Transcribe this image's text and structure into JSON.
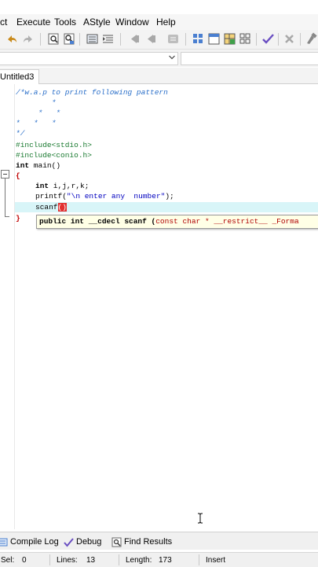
{
  "menubar": {
    "items": [
      "ct",
      "Execute",
      "Tools",
      "AStyle",
      "Window",
      "Help"
    ]
  },
  "toolbar": {
    "icons": [
      "undo-icon",
      "redo-icon",
      "find-icon",
      "replace-icon",
      "indent-icon",
      "unindent-icon",
      "bookmark-prev-icon",
      "bookmark-next-icon",
      "bookmark-toggle-icon",
      "grid-icon",
      "new-class-icon",
      "new-project-icon",
      "compile-icon",
      "check-icon",
      "stop-icon",
      "debug-icon"
    ]
  },
  "tabs": [
    {
      "label": "Untitled3"
    }
  ],
  "editor": {
    "lines": [
      "/*w.a.p to print following pattern",
      "        *",
      "     *   *",
      "*   *   *",
      "*/",
      "#include<stdio.h>",
      "#include<conio.h>",
      "int main()",
      "{",
      "    int i,j,r,k;",
      "    printf(\"\\n enter any  number\");",
      "    scanf()",
      "}"
    ],
    "code": {
      "l1": "/*w.a.p to print following pattern",
      "l2": "        *",
      "l3": "     *   *",
      "l4": "*   *   *",
      "l5": "*/",
      "l6": "#include<stdio.h>",
      "l7": "#include<conio.h>",
      "l8_kw": "int",
      "l8_rest": " main()",
      "l9": "{",
      "l10_kw": "int",
      "l10_rest": " i,j,r,k;",
      "l11_fn": "printf(",
      "l11_str": "\"\\n enter any  number\"",
      "l11_end": ");",
      "l12_fn": "scanf",
      "l12_paren": "()",
      "l13": "}"
    },
    "tooltip": {
      "prefix": "public int __cdecl scanf (",
      "param": "const char * __restrict__ _Forma"
    }
  },
  "bottom_tabs": [
    {
      "label": "Compile Log",
      "icon": "compile-log-icon"
    },
    {
      "label": "Debug",
      "icon": "debug-check-icon"
    },
    {
      "label": "Find Results",
      "icon": "find-results-icon"
    }
  ],
  "status": {
    "sel_label": "Sel:",
    "sel_value": "0",
    "lines_label": "Lines:",
    "lines_value": "13",
    "length_label": "Length:",
    "length_value": "173",
    "mode": "Insert"
  }
}
